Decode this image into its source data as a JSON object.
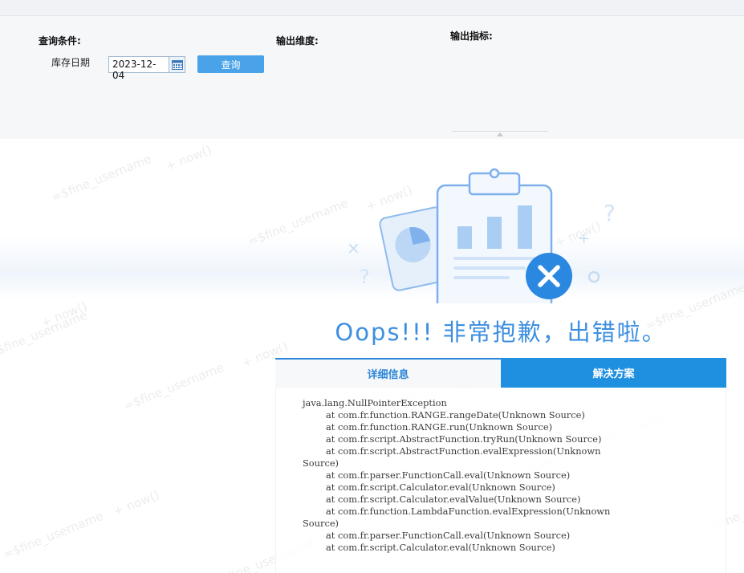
{
  "query": {
    "conditions_label": "查询条件:",
    "dimension_label": "输出维度:",
    "metrics_label": "输出指标:",
    "date_label": "库存日期",
    "date_value": "2023-12-04",
    "query_button": "查询"
  },
  "error": {
    "title": "Oops!!! 非常抱歉，出错啦。",
    "tab_detail": "详细信息",
    "tab_solution": "解决方案",
    "stack_lines": [
      "java.lang.NullPointerException",
      "        at com.fr.function.RANGE.rangeDate(Unknown Source)",
      "        at com.fr.function.RANGE.run(Unknown Source)",
      "        at com.fr.script.AbstractFunction.tryRun(Unknown Source)",
      "        at com.fr.script.AbstractFunction.evalExpression(Unknown",
      "Source)",
      "        at com.fr.parser.FunctionCall.eval(Unknown Source)",
      "        at com.fr.script.Calculator.eval(Unknown Source)",
      "        at com.fr.script.Calculator.evalValue(Unknown Source)",
      "        at com.fr.function.LambdaFunction.evalExpression(Unknown",
      "Source)",
      "        at com.fr.parser.FunctionCall.eval(Unknown Source)",
      "        at com.fr.script.Calculator.eval(Unknown Source)"
    ]
  },
  "watermark": {
    "username_text": "=$fine_username",
    "now_text": "+ now()"
  },
  "colors": {
    "accent": "#3d8fe0",
    "tab_active": "#1f8fe0",
    "query_button": "#4aa3e8",
    "error_icon": "#2b88e0"
  },
  "icons": [
    "calendar-icon",
    "clipboard-chart-illustration",
    "error-x-icon"
  ]
}
